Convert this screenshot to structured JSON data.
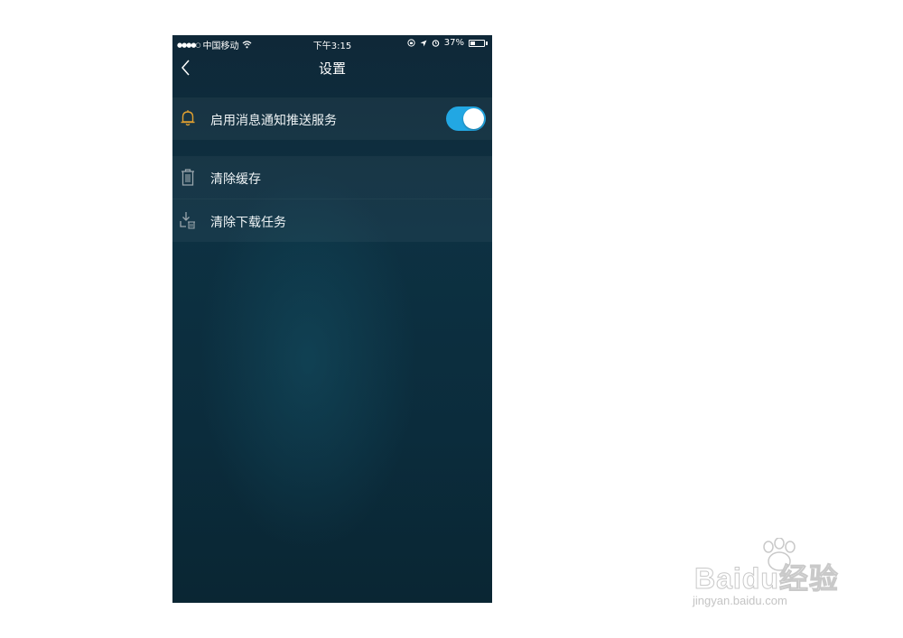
{
  "status_bar": {
    "signal": "●●●●○",
    "carrier": "中国移动",
    "time": "下午3:15",
    "battery_percent": "37%",
    "battery_level": 0.37
  },
  "navbar": {
    "title": "设置",
    "back_icon": "chevron-left-icon"
  },
  "settings": {
    "push_notification": {
      "label": "启用消息通知推送服务",
      "icon": "bell-icon",
      "icon_color": "#e0a030",
      "enabled": true,
      "toggle_color": "#22a7e3"
    },
    "clear_cache": {
      "label": "清除缓存",
      "icon": "trash-icon"
    },
    "clear_downloads": {
      "label": "清除下载任务",
      "icon": "download-trash-icon"
    }
  },
  "watermark": {
    "logo_text": "Baidu经验",
    "url": "jingyan.baidu.com"
  }
}
